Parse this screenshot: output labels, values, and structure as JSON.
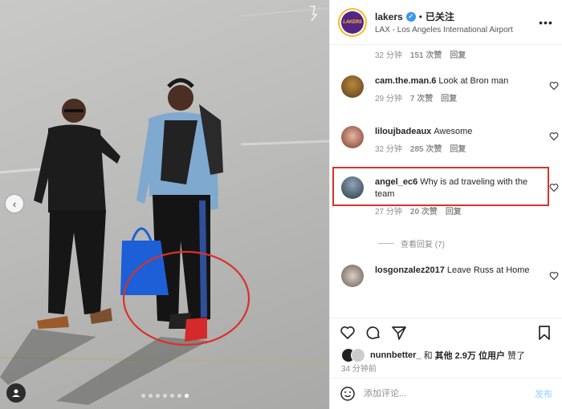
{
  "post": {
    "username": "lakers",
    "follow_label": "已关注",
    "separator": "•",
    "location": "LAX - Los Angeles International Airport",
    "avatar_text": "LAKERS",
    "verified_mark": "✓",
    "more_label": "•••"
  },
  "carousel": {
    "prev_label": "‹",
    "slide_count": 7,
    "active_slide": 6
  },
  "comments": {
    "top_meta": {
      "time": "32 分钟",
      "likes": "151 次赞",
      "reply": "回复"
    },
    "items": [
      {
        "username": "cam.the.man.6",
        "text": "Look at Bron man",
        "time": "29 分钟",
        "likes": "7 次赞",
        "reply": "回复"
      },
      {
        "username": "liloujbadeaux",
        "text": "Awesome",
        "time": "32 分钟",
        "likes": "285 次赞",
        "reply": "回复"
      },
      {
        "username": "angel_ec6",
        "text": "Why is ad traveling with the team",
        "time": "27 分钟",
        "likes": "20 次赞",
        "reply": "回复"
      },
      {
        "username": "losgonzalez2017",
        "text": "Leave Russ at Home"
      }
    ],
    "view_replies": "查看回复 (7)"
  },
  "likes": {
    "user": "nunnbetter_",
    "conj": "和",
    "others": "其他 2.9万 位用户",
    "suffix": "赞了"
  },
  "posted_time": "34 分钟前",
  "add_comment": {
    "placeholder": "添加评论...",
    "post_label": "发布"
  },
  "colors": {
    "accent_red": "#d9322a",
    "lakers_purple": "#552583",
    "lakers_gold": "#fdb927",
    "link_blue": "#3897f0"
  }
}
